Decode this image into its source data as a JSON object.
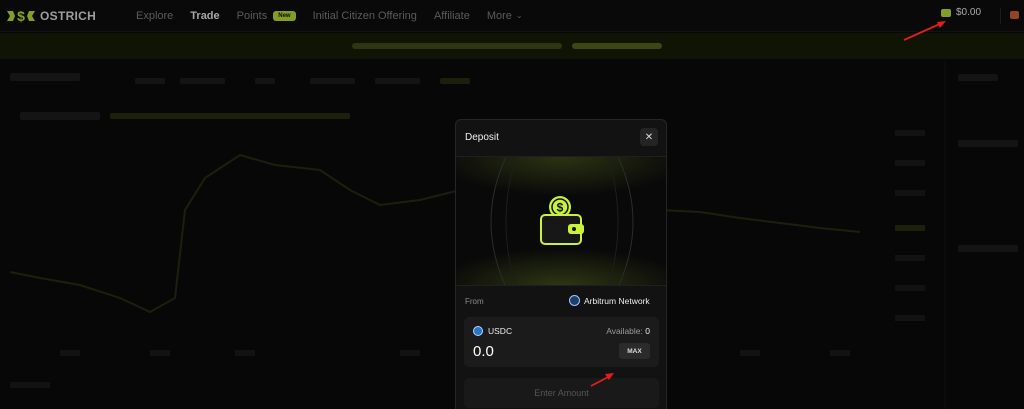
{
  "brand": {
    "name": "OSTRICH"
  },
  "nav": {
    "items": [
      {
        "label": "Explore",
        "active": false
      },
      {
        "label": "Trade",
        "active": true
      },
      {
        "label": "Points",
        "active": false,
        "badge": "New"
      },
      {
        "label": "Initial Citizen Offering",
        "active": false
      },
      {
        "label": "Affiliate",
        "active": false
      },
      {
        "label": "More",
        "active": false
      }
    ]
  },
  "wallet": {
    "balance": "$0.00"
  },
  "deposit_modal": {
    "title": "Deposit",
    "close_label": "✕",
    "from_label": "From",
    "network": "Arbitrum Network",
    "token": "USDC",
    "available_label": "Available:",
    "available_value": "0",
    "amount": "0.0",
    "max_label": "MAX",
    "submit_label": "Enter Amount"
  },
  "colors": {
    "accent": "#c9f33a",
    "annotation_arrow": "#e01e1e"
  }
}
